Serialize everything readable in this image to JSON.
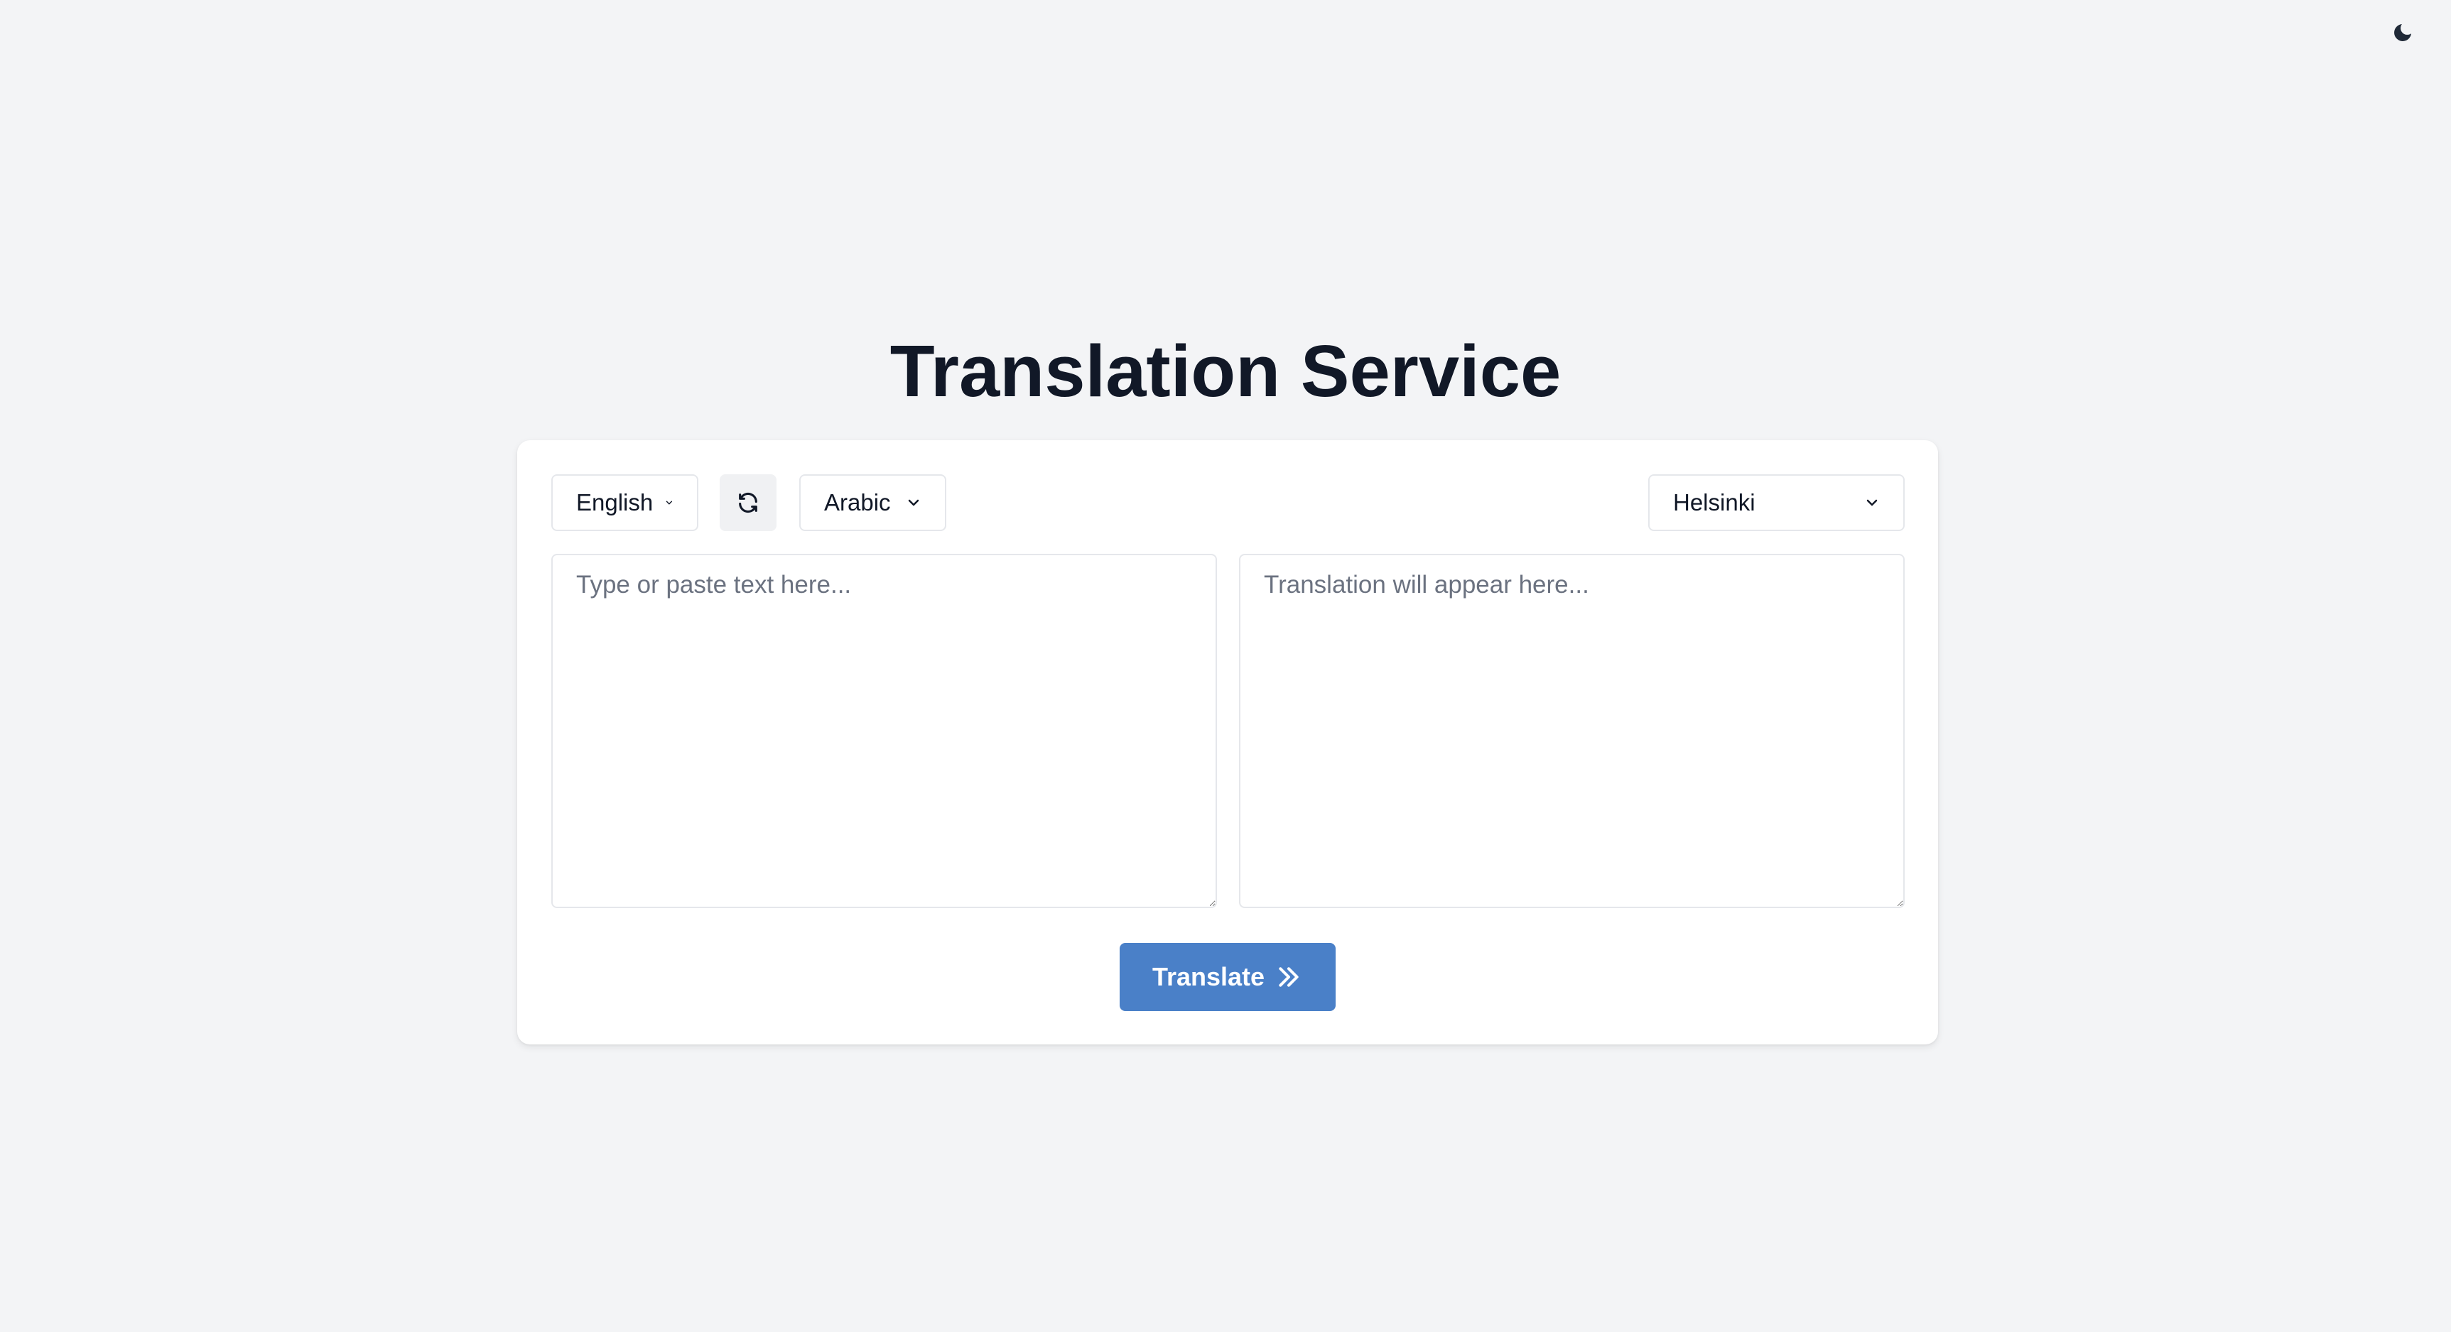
{
  "header": {
    "title": "Translation Service",
    "theme_toggle_icon": "moon-icon"
  },
  "controls": {
    "source_language": "English",
    "target_language": "Arabic",
    "model": "Helsinki",
    "swap_icon": "swap-icon",
    "dropdown_icon": "chevron-down-icon"
  },
  "source": {
    "placeholder": "Type or paste text here...",
    "value": ""
  },
  "target": {
    "placeholder": "Translation will appear here...",
    "value": ""
  },
  "actions": {
    "translate_label": "Translate",
    "translate_icon": "chevrons-right-icon"
  },
  "colors": {
    "background": "#f3f4f6",
    "card": "#ffffff",
    "primary": "#4a80c8",
    "title": "#111827"
  }
}
